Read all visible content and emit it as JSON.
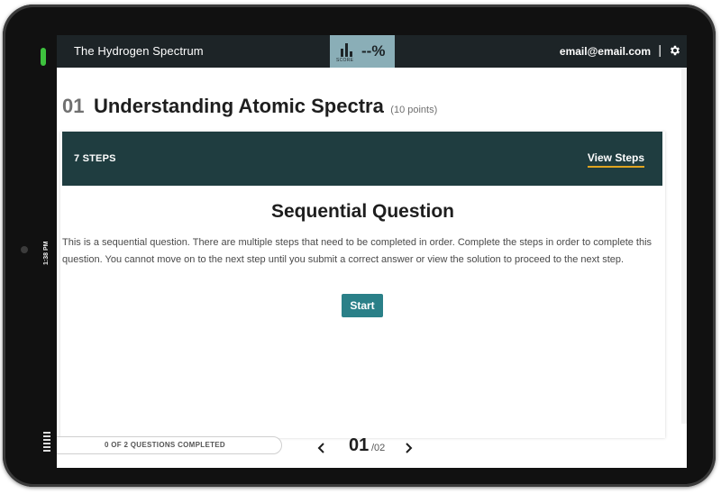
{
  "device": {
    "status_time": "1:38 PM"
  },
  "topbar": {
    "title": "The Hydrogen Spectrum",
    "score_label": "SCORE",
    "score_value": "--%",
    "email": "email@email.com",
    "divider": "|"
  },
  "question": {
    "number": "01",
    "title": "Understanding Atomic Spectra",
    "points": "(10 points)"
  },
  "steps": {
    "count_label": "7 STEPS",
    "view_label": "View Steps"
  },
  "section": {
    "title": "Sequential Question",
    "description": "This is a sequential question. There are multiple steps that need to be completed in order. Complete the steps in order to complete this question. You cannot move on to the next step until you submit a correct answer or view the solution to proceed to the next step.",
    "start_label": "Start"
  },
  "footer": {
    "progress_text": "0 OF 2 QUESTIONS COMPLETED",
    "current_page": "01",
    "total_pages": "/02"
  },
  "colors": {
    "topbar_bg": "#1d2427",
    "score_bg": "#8aaeb7",
    "steps_bar_bg": "#1f3d40",
    "view_steps_underline": "#e0a520",
    "start_button_bg": "#2a8088"
  },
  "icons": {
    "score": "bar-chart-icon",
    "settings": "gear-icon",
    "prev": "chevron-left-icon",
    "next": "chevron-right-icon"
  }
}
